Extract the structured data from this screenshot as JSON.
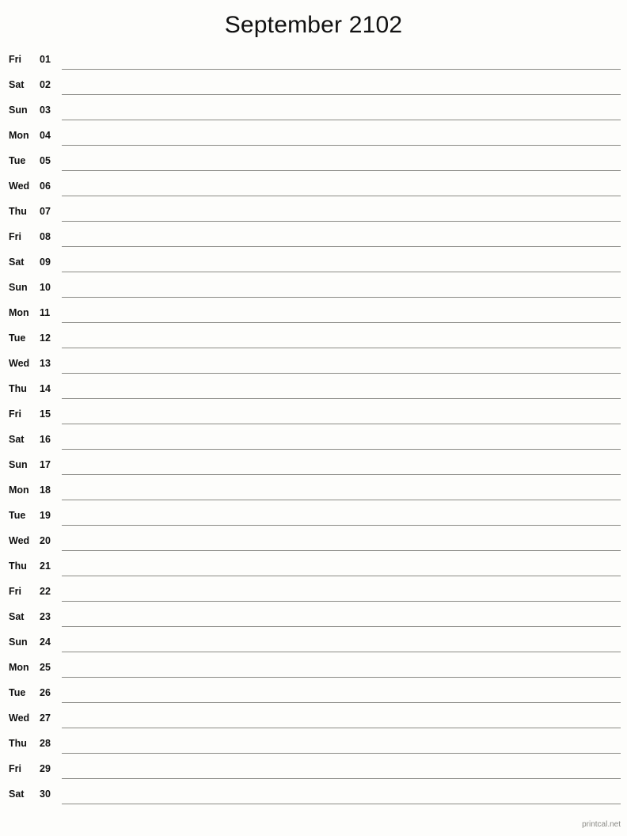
{
  "title": "September 2102",
  "month": "September",
  "year": "2102",
  "colors": {
    "background": "#fdfdfb",
    "text": "#111111",
    "rule": "#8a8a85",
    "footer_text": "#8a8a85"
  },
  "footer": {
    "credit": "printcal.net"
  },
  "days": [
    {
      "weekday": "Fri",
      "date": "01"
    },
    {
      "weekday": "Sat",
      "date": "02"
    },
    {
      "weekday": "Sun",
      "date": "03"
    },
    {
      "weekday": "Mon",
      "date": "04"
    },
    {
      "weekday": "Tue",
      "date": "05"
    },
    {
      "weekday": "Wed",
      "date": "06"
    },
    {
      "weekday": "Thu",
      "date": "07"
    },
    {
      "weekday": "Fri",
      "date": "08"
    },
    {
      "weekday": "Sat",
      "date": "09"
    },
    {
      "weekday": "Sun",
      "date": "10"
    },
    {
      "weekday": "Mon",
      "date": "11"
    },
    {
      "weekday": "Tue",
      "date": "12"
    },
    {
      "weekday": "Wed",
      "date": "13"
    },
    {
      "weekday": "Thu",
      "date": "14"
    },
    {
      "weekday": "Fri",
      "date": "15"
    },
    {
      "weekday": "Sat",
      "date": "16"
    },
    {
      "weekday": "Sun",
      "date": "17"
    },
    {
      "weekday": "Mon",
      "date": "18"
    },
    {
      "weekday": "Tue",
      "date": "19"
    },
    {
      "weekday": "Wed",
      "date": "20"
    },
    {
      "weekday": "Thu",
      "date": "21"
    },
    {
      "weekday": "Fri",
      "date": "22"
    },
    {
      "weekday": "Sat",
      "date": "23"
    },
    {
      "weekday": "Sun",
      "date": "24"
    },
    {
      "weekday": "Mon",
      "date": "25"
    },
    {
      "weekday": "Tue",
      "date": "26"
    },
    {
      "weekday": "Wed",
      "date": "27"
    },
    {
      "weekday": "Thu",
      "date": "28"
    },
    {
      "weekday": "Fri",
      "date": "29"
    },
    {
      "weekday": "Sat",
      "date": "30"
    }
  ]
}
